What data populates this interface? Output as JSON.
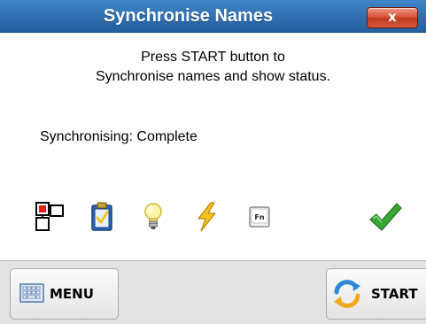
{
  "window": {
    "title": "Synchronise Names",
    "close_label": "x"
  },
  "instructions": {
    "line1": "Press START button to",
    "line2": "Synchronise names and show status."
  },
  "status": {
    "text": "Synchronising: Complete"
  },
  "icons": [
    {
      "name": "network-location-icon"
    },
    {
      "name": "clipboard-icon"
    },
    {
      "name": "lightbulb-icon"
    },
    {
      "name": "lightning-icon"
    },
    {
      "name": "fn-key-icon",
      "text": "Fn"
    },
    {
      "name": "checkmark-icon"
    }
  ],
  "footer": {
    "menu_label": "MENU",
    "start_label": "START"
  },
  "colors": {
    "titlebar": "#2f6fb0",
    "close_button": "#c94a2e",
    "check_green": "#3aa634",
    "footer_bg": "#e3e3e3"
  }
}
